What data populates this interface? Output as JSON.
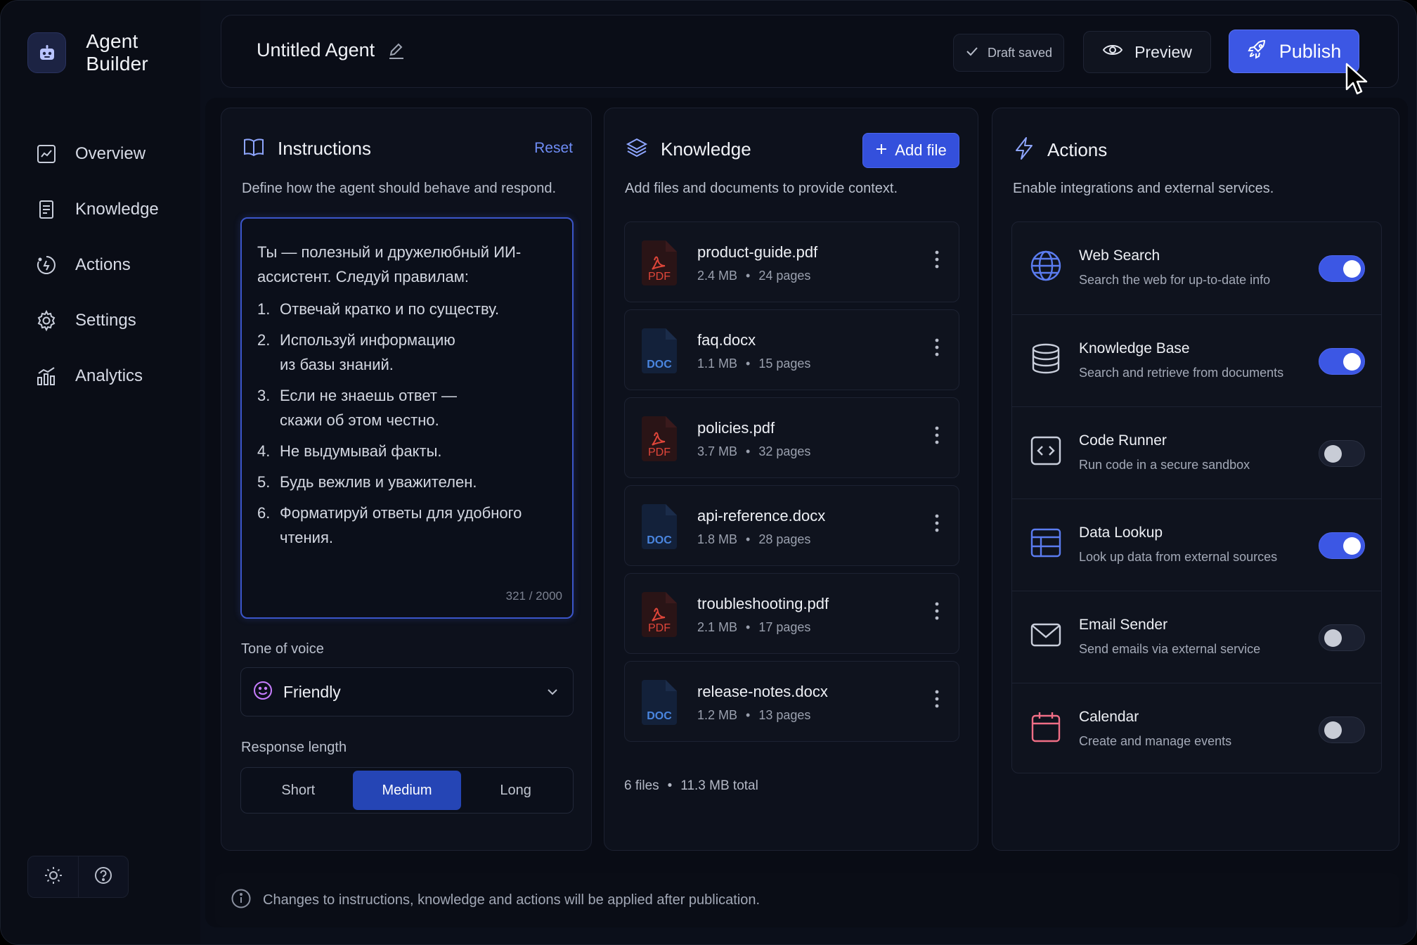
{
  "app": {
    "name": "Agent Builder",
    "agent_title": "Untitled Agent",
    "draft_status": "Draft saved",
    "preview_label": "Preview",
    "publish_label": "Publish"
  },
  "sidebar": {
    "items": [
      {
        "label": "Overview",
        "icon": "chart-icon"
      },
      {
        "label": "Knowledge",
        "icon": "book-icon"
      },
      {
        "label": "Actions",
        "icon": "actions-icon"
      },
      {
        "label": "Settings",
        "icon": "gear-icon"
      },
      {
        "label": "Analytics",
        "icon": "analytics-icon"
      }
    ]
  },
  "instructions": {
    "title": "Instructions",
    "reset_label": "Reset",
    "subtitle": "Define how the agent should behave and respond.",
    "intro": "Ты — полезный и дружелюбный ИИ-ассистент. Следуй правилам:",
    "rules": [
      {
        "n": "1.",
        "text": "Отвечай кратко и по существу."
      },
      {
        "n": "2.",
        "text": "Используй информацию из базы знаний."
      },
      {
        "n": "3.",
        "text": "Если не знаешь ответ — скажи об этом честно."
      },
      {
        "n": "4.",
        "text": "Не выдумывай факты."
      },
      {
        "n": "5.",
        "text": "Будь вежлив и уважителен."
      },
      {
        "n": "6.",
        "text": "Форматируй ответы для удобного чтения."
      }
    ],
    "counter": "321 / 2000",
    "tone_label": "Tone of voice",
    "tone_value": "Friendly",
    "length_label": "Response length",
    "length_options": [
      "Short",
      "Medium",
      "Long"
    ],
    "length_selected": "Medium"
  },
  "knowledge": {
    "title": "Knowledge",
    "subtitle": "Add files and documents to provide context.",
    "add_label": "Add file",
    "files": [
      {
        "name": "product-guide.pdf",
        "type": "PDF",
        "size": "2.4 MB",
        "pages": "24 pages"
      },
      {
        "name": "faq.docx",
        "type": "DOC",
        "size": "1.1 MB",
        "pages": "15 pages"
      },
      {
        "name": "policies.pdf",
        "type": "PDF",
        "size": "3.7 MB",
        "pages": "32 pages"
      },
      {
        "name": "api-reference.docx",
        "type": "DOC",
        "size": "1.8 MB",
        "pages": "28 pages"
      },
      {
        "name": "troubleshooting.pdf",
        "type": "PDF",
        "size": "2.1 MB",
        "pages": "17 pages"
      },
      {
        "name": "release-notes.docx",
        "type": "DOC",
        "size": "1.2 MB",
        "pages": "13 pages"
      }
    ],
    "total_files": "6 files",
    "total_size": "11.3 MB total"
  },
  "actions": {
    "title": "Actions",
    "subtitle": "Enable integrations and external services.",
    "items": [
      {
        "name": "Web Search",
        "desc": "Search the web for up-to-date info",
        "enabled": true,
        "icon": "globe-icon"
      },
      {
        "name": "Knowledge Base",
        "desc": "Search and retrieve from documents",
        "enabled": true,
        "icon": "database-icon"
      },
      {
        "name": "Code Runner",
        "desc": "Run code in a secure sandbox",
        "enabled": false,
        "icon": "code-icon"
      },
      {
        "name": "Data Lookup",
        "desc": "Look up data from external sources",
        "enabled": true,
        "icon": "table-icon"
      },
      {
        "name": "Email Sender",
        "desc": "Send emails via external service",
        "enabled": false,
        "icon": "mail-icon"
      },
      {
        "name": "Calendar",
        "desc": "Create and manage events",
        "enabled": false,
        "icon": "calendar-icon"
      }
    ]
  },
  "footer": {
    "note": "Changes to instructions, knowledge and actions will be applied after publication."
  },
  "colors": {
    "accent": "#3c57e4",
    "pdf": "#e0463a",
    "doc": "#3b78d8",
    "link": "#6f8df6"
  }
}
